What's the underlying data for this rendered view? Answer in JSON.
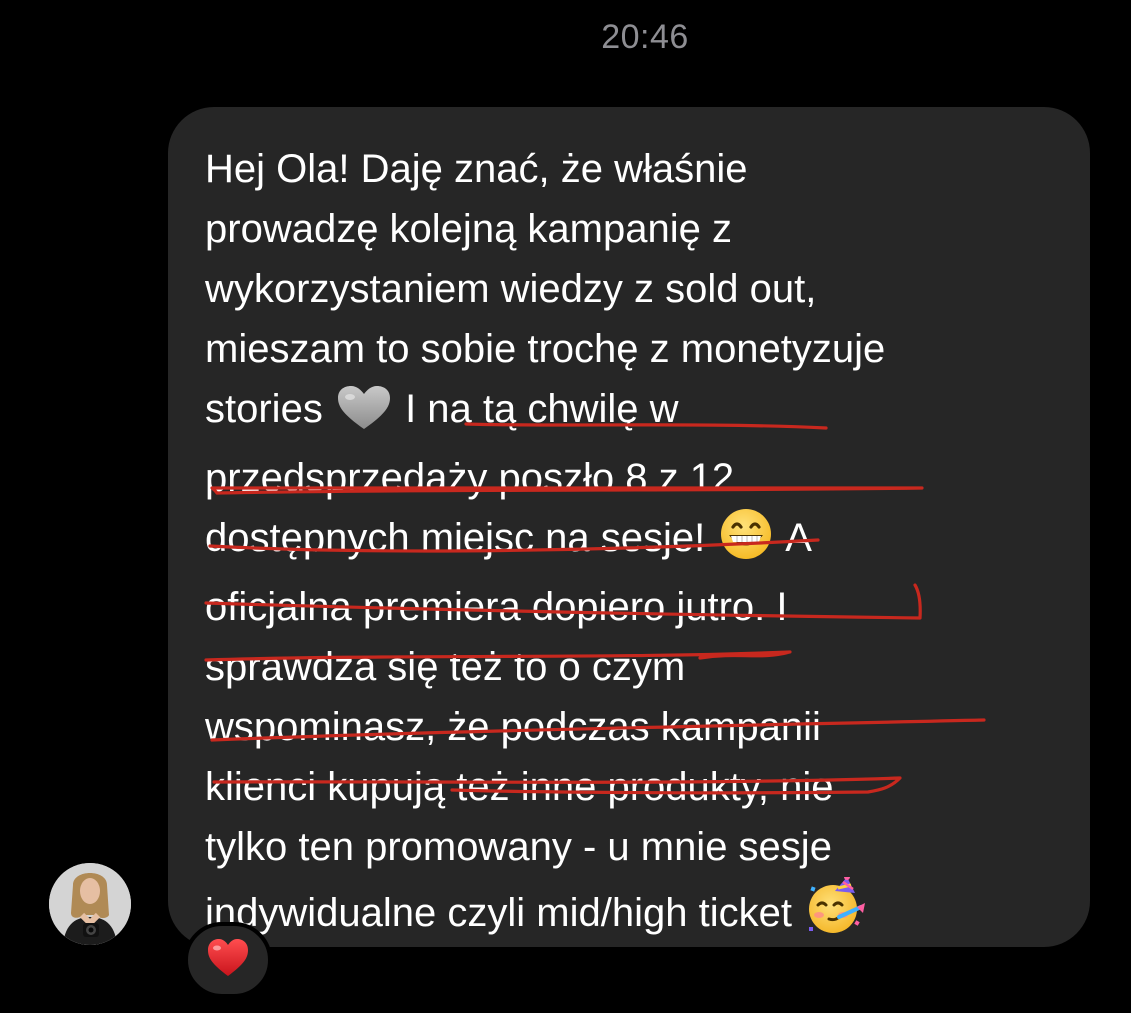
{
  "timestamp": "20:46",
  "message": {
    "lines": [
      "Hej Ola! Daję znać, że właśnie",
      "prowadzę kolejną kampanię z",
      "wykorzystaniem wiedzy z sold out,",
      "mieszam to sobie trochę z monetyzuje",
      "stories",
      "I na tą chwilę w",
      "przedsprzedaży poszło 8 z 12",
      "dostępnych miejsc na sesje!",
      "A",
      "oficjalna premiera dopiero jutro. I",
      "sprawdza się też to o czym",
      "wspominasz, że podczas kampanii",
      "klienci kupują też inne produkty, nie",
      "tylko ten promowany - u mnie sesje",
      "indywidualne czyli mid/high ticket"
    ],
    "emojis": {
      "heart": "grey-heart-emoji",
      "grin": "grinning-face-emoji",
      "party": "partying-face-emoji"
    }
  },
  "reaction": {
    "emoji": "red-heart-emoji"
  },
  "colors": {
    "background": "#000000",
    "bubble": "#262626",
    "text": "#ffffff",
    "timestamp": "#8e8e93",
    "underline": "#c8281e",
    "reaction_heart": "#e0202a"
  }
}
